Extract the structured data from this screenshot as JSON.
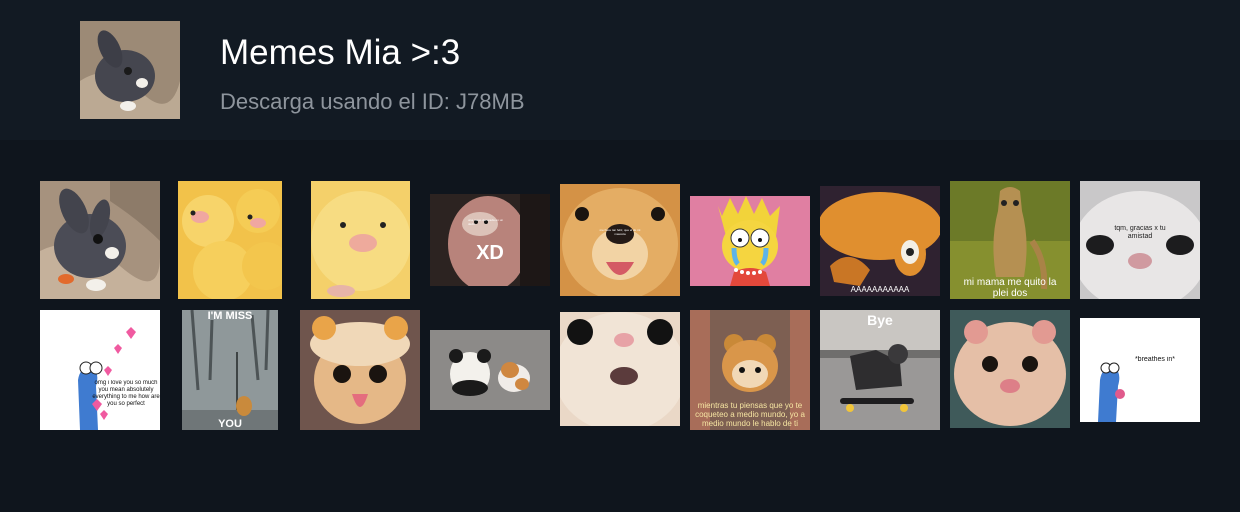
{
  "header": {
    "title": "Memes Mia >:3",
    "subtitle": "Descarga usando el ID: J78MB"
  },
  "stickers": [
    {
      "name": "sticker-bunny",
      "caption": ""
    },
    {
      "name": "sticker-ducklings",
      "caption": ""
    },
    {
      "name": "sticker-duckling",
      "caption": ""
    },
    {
      "name": "sticker-xd-hamster",
      "caption": "XD",
      "small_text": "una mano decorada en un dedo"
    },
    {
      "name": "sticker-dog-smiling",
      "caption": "",
      "small_text": "me hace tan feliz, que el de mi mascota"
    },
    {
      "name": "sticker-lisa-crying",
      "caption": ""
    },
    {
      "name": "sticker-jake-screaming",
      "caption": "AAAAAAAAAAA"
    },
    {
      "name": "sticker-mi-mama",
      "caption": "mi mama me quito la plei dos"
    },
    {
      "name": "sticker-cat-thanks",
      "caption": "tqm, gracias x tu amistad"
    },
    {
      "name": "sticker-worm-love",
      "caption": "omg i love you so much you mean absolutely everything to me how are you so perfect"
    },
    {
      "name": "sticker-im-miss-you",
      "caption_top": "I'M MISS",
      "caption_bottom": "YOU"
    },
    {
      "name": "sticker-cat-bear-hat",
      "caption": ""
    },
    {
      "name": "sticker-panda-cat",
      "caption": ""
    },
    {
      "name": "sticker-cat-closeup",
      "caption": ""
    },
    {
      "name": "sticker-cat-costume",
      "caption": "mientras tu piensas que yo te coqueteo a medio mundo, yo a medio mundo le hablo de ti"
    },
    {
      "name": "sticker-cat-skateboard",
      "caption": "Bye"
    },
    {
      "name": "sticker-hamster",
      "caption": ""
    },
    {
      "name": "sticker-breathes-in",
      "caption": "*breathes in*"
    }
  ],
  "colors": {
    "background": "#0f151d",
    "header_background": "#121a23",
    "title": "#ffffff",
    "subtitle": "#8e959d"
  }
}
